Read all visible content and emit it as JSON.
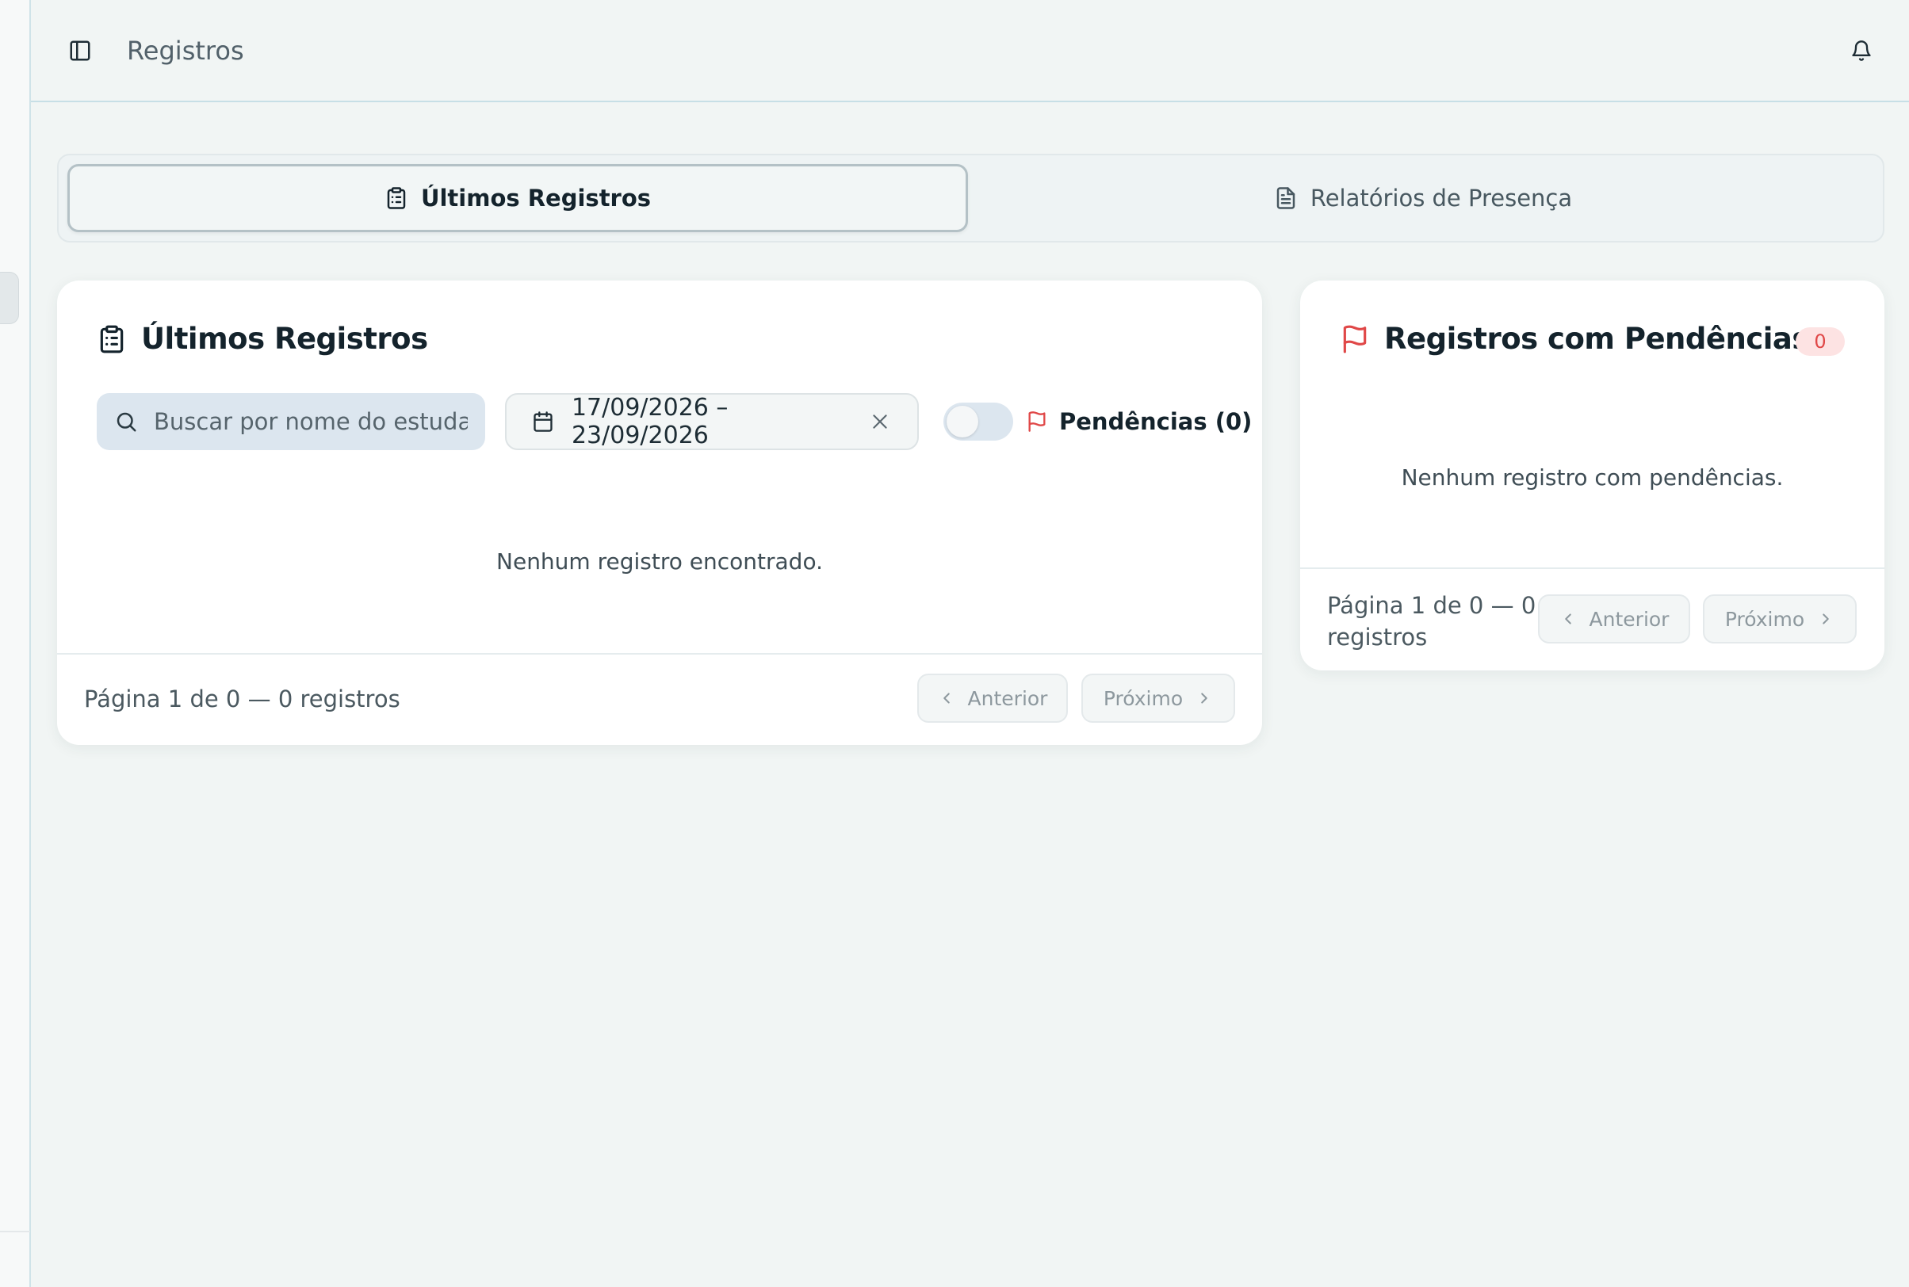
{
  "header": {
    "title": "Registros",
    "sidebar_toggle_icon": "panel-left-icon",
    "notification_icon": "bell-icon"
  },
  "tabs": [
    {
      "label": "Últimos Registros",
      "icon": "clipboard-list-icon",
      "active": true
    },
    {
      "label": "Relatórios de Presença",
      "icon": "file-text-icon",
      "active": false
    }
  ],
  "latest": {
    "title": "Últimos Registros",
    "icon": "clipboard-list-icon",
    "search": {
      "placeholder": "Buscar por nome do estudante",
      "value": ""
    },
    "date_range": "17/09/2026 – 23/09/2026",
    "pending_toggle": {
      "on": false,
      "label": "Pendências (0)"
    },
    "empty_message": "Nenhum registro encontrado.",
    "footer": {
      "summary": "Página 1 de 0 — 0 registros",
      "prev_label": "Anterior",
      "next_label": "Próximo"
    }
  },
  "pending": {
    "title": "Registros com Pendências",
    "icon": "flag-icon",
    "count": "0",
    "empty_message": "Nenhum registro com pendências.",
    "footer": {
      "summary": "Página 1 de 0 — 0 registros",
      "prev_label": "Anterior",
      "next_label": "Próximo"
    }
  },
  "colors": {
    "background": "#f1f5f4",
    "card": "#ffffff",
    "flag": "#e04848",
    "badge_bg": "#fde3e3",
    "search_bg": "#dce6ef"
  }
}
